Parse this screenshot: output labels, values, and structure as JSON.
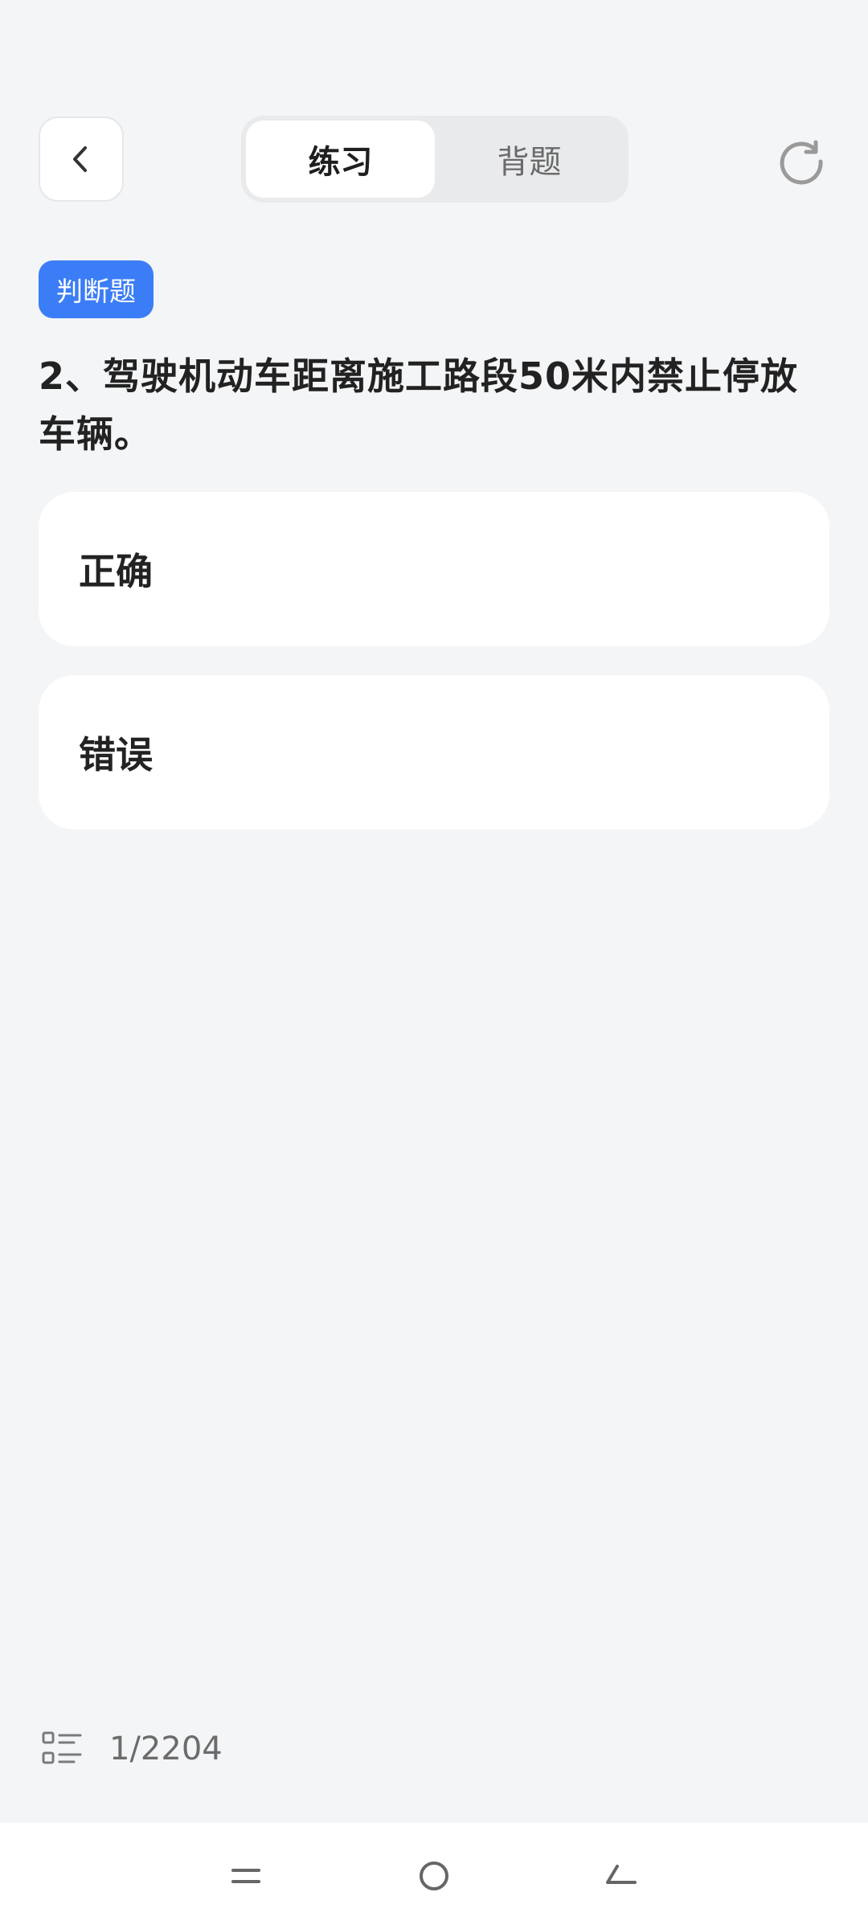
{
  "header": {
    "back_icon": "chevron-left-icon",
    "tabs": [
      {
        "label": "练习",
        "active": true
      },
      {
        "label": "背题",
        "active": false
      }
    ],
    "reset_icon": "refresh-icon"
  },
  "question": {
    "type_badge": "判断题",
    "text": "2、驾驶机动车距离施工路段50米内禁止停放车辆。",
    "options": [
      {
        "label": "正确"
      },
      {
        "label": "错误"
      }
    ]
  },
  "footer": {
    "list_icon": "question-list-icon",
    "progress_text": "1/2204"
  },
  "navbar": {
    "icons": [
      "menu-icon",
      "home-icon",
      "back-icon"
    ]
  },
  "colors": {
    "background": "#f4f5f7",
    "accent": "#3b7df6"
  }
}
